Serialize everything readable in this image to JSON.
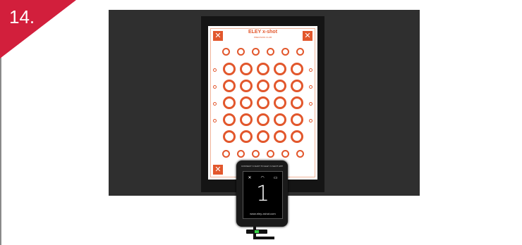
{
  "step": {
    "number": "14."
  },
  "target": {
    "brand": "ELEY x-shot",
    "subtitle": "PRECISION CLUB",
    "corner_icon": "x-mark"
  },
  "device": {
    "label": "CONNECT X-SHOT TO ELEY X-SHOT APP",
    "icons": [
      "x-shot-icon",
      "wifi-icon",
      "battery-icon"
    ],
    "shot_count": "1",
    "url": "www.eley-xshot.com"
  },
  "colors": {
    "flag": "#d21f3c",
    "target_orange": "#e2572c",
    "level_green": "#38d447"
  }
}
